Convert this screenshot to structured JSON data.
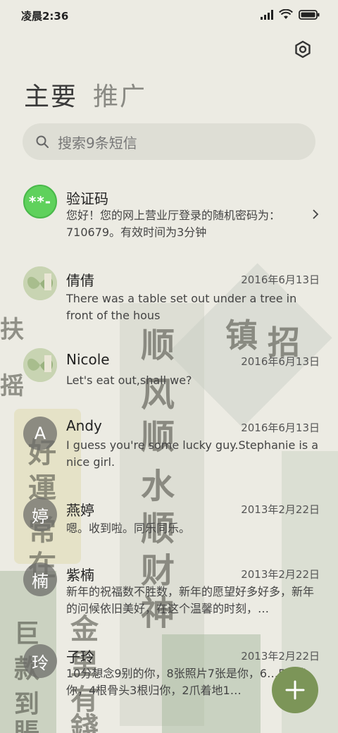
{
  "status_bar": {
    "time": "凌晨2:36"
  },
  "tabs": [
    {
      "label": "主要",
      "active": true
    },
    {
      "label": "推广",
      "active": false
    }
  ],
  "search": {
    "placeholder": "搜索9条短信"
  },
  "conversations": [
    {
      "avatar_type": "text",
      "avatar_text": "**-",
      "name": "验证码",
      "date": "",
      "preview": "您好！您的网上营业厅登录的随机密码为：710679。有效时间为3分钟",
      "has_chevron": true
    },
    {
      "avatar_type": "photo",
      "avatar_text": "",
      "name": "倩倩",
      "date": "2016年6月13日",
      "preview": "There was a table set out under a tree in front of the hous"
    },
    {
      "avatar_type": "photo",
      "avatar_text": "",
      "name": "Nicole",
      "date": "2016年6月13日",
      "preview": "Let's eat out,shall we?"
    },
    {
      "avatar_type": "letter",
      "avatar_text": "A",
      "name": "Andy",
      "date": "2016年6月13日",
      "preview": "I guess you're some lucky guy.Stephanie is a nice girl."
    },
    {
      "avatar_type": "letter",
      "avatar_text": "婷",
      "name": "燕婷",
      "date": "2013年2月22日",
      "preview": "嗯。收到啦。同乐同乐。"
    },
    {
      "avatar_type": "letter",
      "avatar_text": "楠",
      "name": "紫楠",
      "date": "2013年2月22日",
      "preview": "新年的祝福数不胜数，新年的愿望好多好多，新年的问候依旧美好，在这个温馨的时刻，…"
    },
    {
      "avatar_type": "letter",
      "avatar_text": "玲",
      "name": "子玲",
      "date": "2013年2月22日",
      "preview": "10分想念9别的你，8张照片7张是你，6…5只像你，4根骨头3根归你，2爪着地1…"
    }
  ],
  "wallpaper": {
    "glyphs": [
      "顺",
      "风",
      "顺",
      "水",
      "顺",
      "财",
      "神",
      "镇",
      "招",
      "好",
      "運",
      "常",
      "在",
      "金",
      "里",
      "有",
      "錢",
      "巨",
      "款",
      "到",
      "賬",
      "扶",
      "摇"
    ]
  },
  "colors": {
    "accent_green": "#7c9558",
    "verify_avatar": "#5fd15c"
  }
}
